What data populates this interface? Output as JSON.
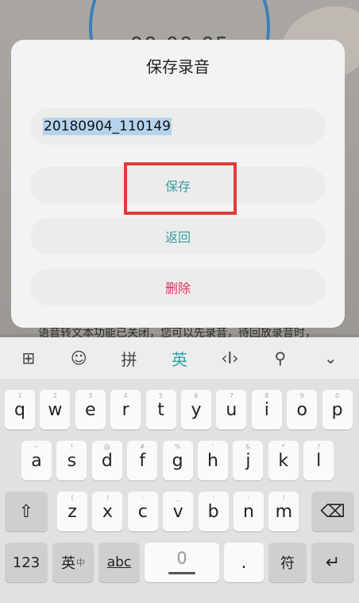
{
  "background": {
    "timer": "00:00:05",
    "hint": "语音转文本功能已关闭，您可以先录音，待回放录音时，"
  },
  "dialog": {
    "title": "保存录音",
    "filename": "20180904_110149",
    "save_label": "保存",
    "back_label": "返回",
    "delete_label": "删除"
  },
  "keyboard": {
    "toolbar": {
      "grid": "⊞",
      "emoji": "☺",
      "pinyin": "拼",
      "english": "英",
      "cursor": "‹I›",
      "search": "⚲",
      "collapse": "⌄"
    },
    "row1": [
      {
        "k": "q",
        "s": "1"
      },
      {
        "k": "w",
        "s": "2"
      },
      {
        "k": "e",
        "s": "3"
      },
      {
        "k": "r",
        "s": "4"
      },
      {
        "k": "t",
        "s": "5"
      },
      {
        "k": "y",
        "s": "6"
      },
      {
        "k": "u",
        "s": "7"
      },
      {
        "k": "i",
        "s": "8"
      },
      {
        "k": "o",
        "s": "9"
      },
      {
        "k": "p",
        "s": "0"
      }
    ],
    "row2": [
      {
        "k": "a",
        "s": "~"
      },
      {
        "k": "s",
        "s": "!"
      },
      {
        "k": "d",
        "s": "@"
      },
      {
        "k": "f",
        "s": "#"
      },
      {
        "k": "g",
        "s": "%"
      },
      {
        "k": "h",
        "s": "'"
      },
      {
        "k": "j",
        "s": "&"
      },
      {
        "k": "k",
        "s": "*"
      },
      {
        "k": "l",
        "s": "?"
      }
    ],
    "row3": [
      {
        "k": "z",
        "s": "("
      },
      {
        "k": "x",
        "s": ")"
      },
      {
        "k": "c",
        "s": "-"
      },
      {
        "k": "v",
        "s": "_"
      },
      {
        "k": "b",
        "s": ":"
      },
      {
        "k": "n",
        "s": ";"
      },
      {
        "k": "m",
        "s": "/"
      }
    ],
    "shift": "⇧",
    "backspace": "⌫",
    "num_label": "123",
    "lang_label": "英",
    "lang_sub": "中",
    "abc_label": "abc",
    "period": ".",
    "fu_label": "符",
    "enter": "↵"
  }
}
